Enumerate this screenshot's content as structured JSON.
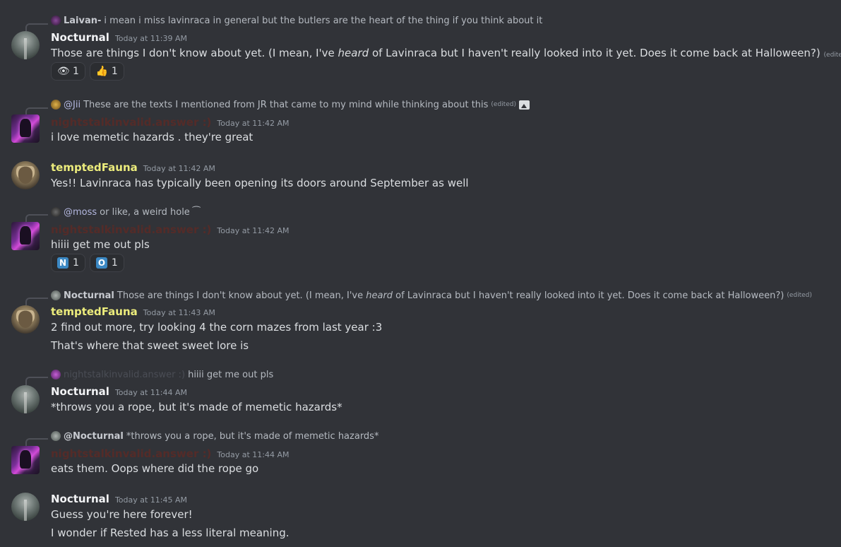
{
  "messages": [
    {
      "reply": {
        "author": "Laivan-",
        "text": "i mean i miss lavinraca in general but the butlers are the heart of the thing if you think about it"
      },
      "author": "Nocturnal",
      "time": "Today at 11:39 AM",
      "text_before": "Those are things I don't know about yet. (I mean, I've ",
      "text_em": "heard",
      "text_after": " of Lavinraca but I haven't really looked into it yet. Does it come back at Halloween?)",
      "edited": "(edited)",
      "reactions": [
        {
          "emoji": "👁",
          "count": "1"
        },
        {
          "emoji": "👍",
          "count": "1"
        }
      ]
    },
    {
      "reply": {
        "mention": "@Jii",
        "text": "These are the texts I mentioned from JR that came to my mind while thinking about this",
        "edited": "(edited)",
        "icon": "image-icon"
      },
      "author": "nightstalkinvalid.answer  :)",
      "time": "Today at 11:42 AM",
      "text": "i love memetic hazards . they're great"
    },
    {
      "author": "temptedFauna",
      "time": "Today at 11:42 AM",
      "text": "Yes!! Lavinraca has typically been opening its doors around September as well"
    },
    {
      "reply": {
        "mention": "@moss",
        "text": "or like, a weird hole ⁀"
      },
      "author": "nightstalkinvalid.answer  :)",
      "time": "Today at 11:42 AM",
      "text": "hiiii get me out pls",
      "reactions": [
        {
          "emoji": "N",
          "count": "1"
        },
        {
          "emoji": "O",
          "count": "1"
        }
      ]
    },
    {
      "reply": {
        "author": "Nocturnal",
        "text_before": "Those are things I don't know about yet. (I mean, I've ",
        "text_em": "heard",
        "text_after": " of Lavinraca but I haven't really looked into it yet. Does it come back at Halloween?)",
        "edited": "(edited)"
      },
      "author": "temptedFauna",
      "time": "Today at 11:43 AM",
      "text": "2 find out more, try looking 4 the corn mazes from last year :3",
      "text2": "That's where that sweet sweet lore is"
    },
    {
      "reply": {
        "author_blur": "nightstalkinvalid.answer :)",
        "text": "hiiii get me out pls"
      },
      "author": "Nocturnal",
      "time": "Today at 11:44 AM",
      "text": "*throws you a rope, but it's made of memetic hazards*"
    },
    {
      "reply": {
        "mention": "@Nocturnal",
        "text": "*throws you a rope, but it's made of memetic hazards*"
      },
      "author": "nightstalkinvalid.answer  :)",
      "time": "Today at 11:44 AM",
      "text": "eats them. Oops where did the rope go"
    },
    {
      "author": "Nocturnal",
      "time": "Today at 11:45 AM",
      "text": "Guess you're here forever!",
      "text2": "I wonder if Rested has a less literal meaning."
    }
  ]
}
